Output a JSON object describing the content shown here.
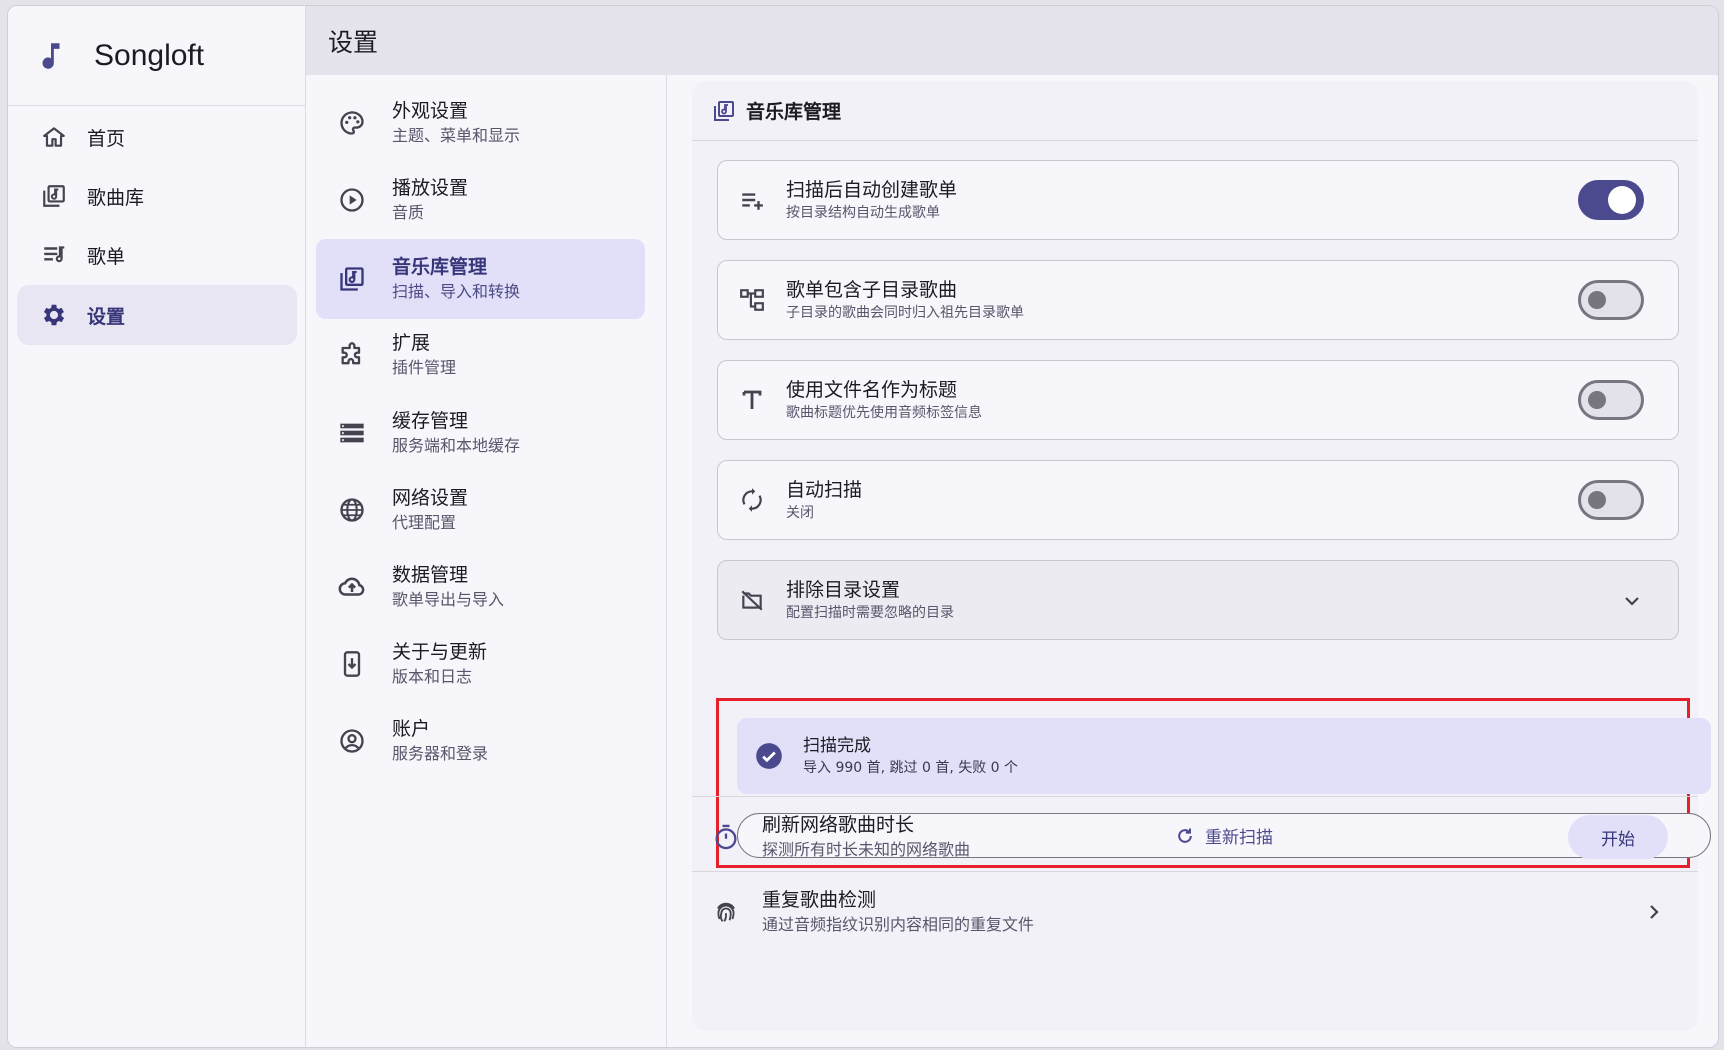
{
  "app": {
    "name": "Songloft"
  },
  "nav": {
    "items": [
      {
        "label": "首页",
        "icon": "home-icon"
      },
      {
        "label": "歌曲库",
        "icon": "library-icon"
      },
      {
        "label": "歌单",
        "icon": "playlist-icon"
      },
      {
        "label": "设置",
        "icon": "gear-icon",
        "active": true
      }
    ]
  },
  "header": {
    "title": "设置"
  },
  "categories": [
    {
      "title": "外观设置",
      "subtitle": "主题、菜单和显示",
      "icon": "palette-icon"
    },
    {
      "title": "播放设置",
      "subtitle": "音质",
      "icon": "play-circle-icon"
    },
    {
      "title": "音乐库管理",
      "subtitle": "扫描、导入和转换",
      "icon": "library-music-icon",
      "active": true
    },
    {
      "title": "扩展",
      "subtitle": "插件管理",
      "icon": "puzzle-icon"
    },
    {
      "title": "缓存管理",
      "subtitle": "服务端和本地缓存",
      "icon": "storage-icon"
    },
    {
      "title": "网络设置",
      "subtitle": "代理配置",
      "icon": "globe-icon"
    },
    {
      "title": "数据管理",
      "subtitle": "歌单导出与导入",
      "icon": "cloud-upload-icon"
    },
    {
      "title": "关于与更新",
      "subtitle": "版本和日志",
      "icon": "phone-download-icon"
    },
    {
      "title": "账户",
      "subtitle": "服务器和登录",
      "icon": "account-circle-icon"
    }
  ],
  "panel": {
    "title": "音乐库管理",
    "options": [
      {
        "title": "扫描后自动创建歌单",
        "subtitle": "按目录结构自动生成歌单",
        "icon": "playlist-add-icon",
        "enabled": true
      },
      {
        "title": "歌单包含子目录歌曲",
        "subtitle": "子目录的歌曲会同时归入祖先目录歌单",
        "icon": "account-tree-icon",
        "enabled": false
      },
      {
        "title": "使用文件名作为标题",
        "subtitle": "歌曲标题优先使用音频标签信息",
        "icon": "text-t-icon",
        "enabled": false
      },
      {
        "title": "自动扫描",
        "subtitle": "关闭",
        "icon": "sync-icon",
        "enabled": false
      }
    ],
    "exclude": {
      "title": "排除目录设置",
      "subtitle": "配置扫描时需要忽略的目录",
      "icon": "folder-off-icon"
    },
    "scan_status": {
      "title": "扫描完成",
      "detail": "导入 990 首, 跳过 0 首, 失败 0 个"
    },
    "rescan_label": "重新扫描",
    "refresh": {
      "title": "刷新网络歌曲时长",
      "subtitle": "探测所有时长未知的网络歌曲",
      "button": "开始"
    },
    "duplicates": {
      "title": "重复歌曲检测",
      "subtitle": "通过音频指纹识别内容相同的重复文件"
    }
  },
  "colors": {
    "accent": "#4c4a8f",
    "active_bg": "#e1e0f8",
    "highlight_border": "#e5202b"
  }
}
